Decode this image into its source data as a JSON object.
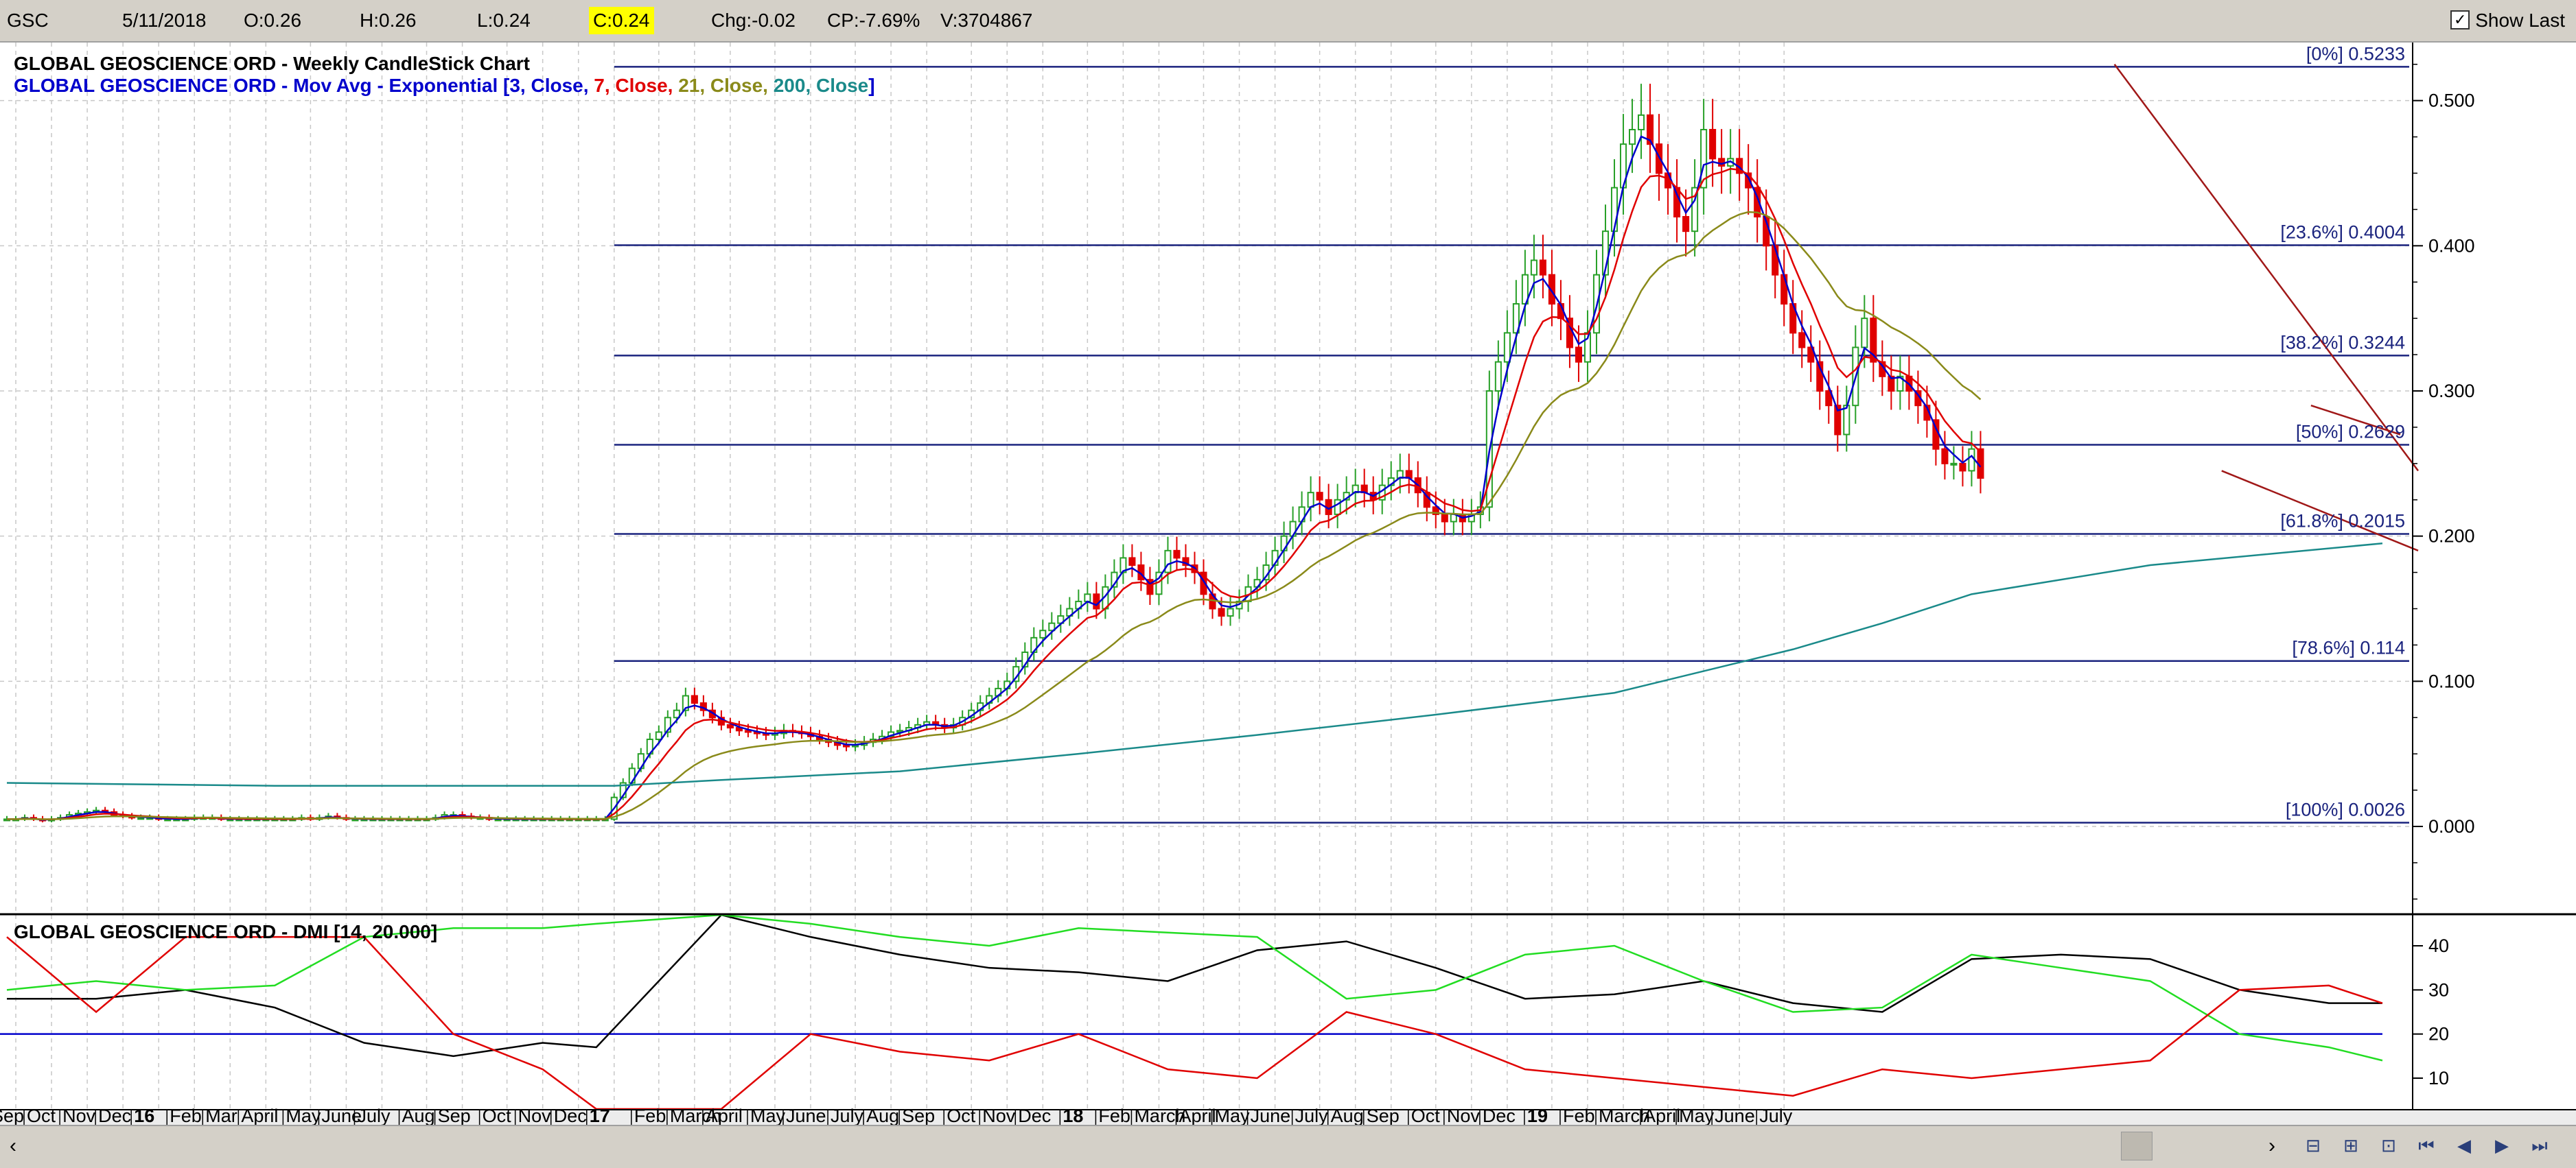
{
  "toolbar": {
    "symbol": "GSC",
    "date": "5/11/2018",
    "open": "O:0.26",
    "high": "H:0.26",
    "low": "L:0.24",
    "close": "C:0.24",
    "change": "Chg:-0.02",
    "change_pct": "CP:-7.69%",
    "volume": "V:3704867",
    "show_last_label": "Show Last",
    "show_last_checked": "✓"
  },
  "chart_data": [
    {
      "type": "candlestick",
      "title": "GLOBAL GEOSCIENCE ORD - Weekly CandleStick Chart",
      "indicator_prefix": "GLOBAL GEOSCIENCE ORD - Mov Avg - Exponential [",
      "indicator_parts": [
        {
          "text": "3, Close, ",
          "color": "#0000cc"
        },
        {
          "text": "7, Close, ",
          "color": "#e00000"
        },
        {
          "text": "21, Close, ",
          "color": "#8a8a1a"
        },
        {
          "text": "200, Close",
          "color": "#1a8a8a"
        }
      ],
      "indicator_suffix": "]",
      "ylim": [
        -0.06,
        0.54
      ],
      "yticks": [
        "0.500",
        "0.400",
        "0.300",
        "0.200",
        "0.100",
        "0.000"
      ],
      "ytick_values": [
        0.5,
        0.4,
        0.3,
        0.2,
        0.1,
        0.0
      ],
      "fib_levels": [
        {
          "label": "[0%] 0.5233",
          "value": 0.5233
        },
        {
          "label": "[23.6%] 0.4004",
          "value": 0.4004
        },
        {
          "label": "[38.2%] 0.3244",
          "value": 0.3244
        },
        {
          "label": "[50%] 0.2629",
          "value": 0.2629
        },
        {
          "label": "[61.8%] 0.2015",
          "value": 0.2015
        },
        {
          "label": "[78.6%] 0.114",
          "value": 0.114
        },
        {
          "label": "[100%] 0.0026",
          "value": 0.0026
        }
      ],
      "fib_start_week": 68,
      "close_series": [
        0.005,
        0.005,
        0.006,
        0.005,
        0.004,
        0.005,
        0.006,
        0.008,
        0.009,
        0.01,
        0.011,
        0.01,
        0.008,
        0.007,
        0.006,
        0.006,
        0.006,
        0.005,
        0.005,
        0.005,
        0.005,
        0.006,
        0.006,
        0.006,
        0.005,
        0.005,
        0.005,
        0.005,
        0.005,
        0.005,
        0.005,
        0.005,
        0.005,
        0.006,
        0.005,
        0.006,
        0.007,
        0.006,
        0.005,
        0.005,
        0.005,
        0.005,
        0.005,
        0.005,
        0.005,
        0.005,
        0.005,
        0.005,
        0.006,
        0.008,
        0.008,
        0.007,
        0.006,
        0.006,
        0.005,
        0.005,
        0.005,
        0.005,
        0.005,
        0.005,
        0.005,
        0.005,
        0.005,
        0.005,
        0.005,
        0.005,
        0.005,
        0.005,
        0.02,
        0.03,
        0.04,
        0.05,
        0.06,
        0.065,
        0.075,
        0.08,
        0.09,
        0.085,
        0.08,
        0.075,
        0.07,
        0.068,
        0.066,
        0.065,
        0.064,
        0.063,
        0.064,
        0.066,
        0.065,
        0.064,
        0.062,
        0.06,
        0.058,
        0.056,
        0.055,
        0.056,
        0.058,
        0.06,
        0.062,
        0.065,
        0.066,
        0.068,
        0.07,
        0.072,
        0.07,
        0.068,
        0.07,
        0.075,
        0.08,
        0.085,
        0.09,
        0.095,
        0.1,
        0.11,
        0.12,
        0.13,
        0.135,
        0.14,
        0.145,
        0.15,
        0.155,
        0.16,
        0.15,
        0.165,
        0.175,
        0.185,
        0.18,
        0.17,
        0.16,
        0.175,
        0.19,
        0.185,
        0.18,
        0.175,
        0.16,
        0.15,
        0.145,
        0.15,
        0.155,
        0.165,
        0.17,
        0.18,
        0.19,
        0.2,
        0.21,
        0.22,
        0.23,
        0.225,
        0.215,
        0.225,
        0.23,
        0.235,
        0.23,
        0.225,
        0.235,
        0.24,
        0.245,
        0.24,
        0.23,
        0.22,
        0.215,
        0.21,
        0.215,
        0.21,
        0.215,
        0.22,
        0.3,
        0.32,
        0.34,
        0.36,
        0.38,
        0.39,
        0.38,
        0.36,
        0.35,
        0.33,
        0.32,
        0.34,
        0.38,
        0.41,
        0.44,
        0.47,
        0.48,
        0.49,
        0.47,
        0.45,
        0.44,
        0.42,
        0.41,
        0.44,
        0.48,
        0.46,
        0.455,
        0.46,
        0.45,
        0.44,
        0.42,
        0.4,
        0.38,
        0.36,
        0.34,
        0.33,
        0.32,
        0.3,
        0.29,
        0.27,
        0.29,
        0.33,
        0.35,
        0.32,
        0.31,
        0.3,
        0.31,
        0.3,
        0.29,
        0.28,
        0.26,
        0.25,
        0.25,
        0.245,
        0.26,
        0.24
      ],
      "ema": [
        {
          "period": 3,
          "color": "#0000cc"
        },
        {
          "period": 7,
          "color": "#e00000"
        },
        {
          "period": 21,
          "color": "#8a8a1a"
        }
      ],
      "ema200": {
        "color": "#1a8a8a",
        "x": [
          0,
          30,
          68,
          80,
          100,
          120,
          140,
          160,
          180,
          200,
          210,
          220,
          240,
          266
        ],
        "y": [
          0.03,
          0.028,
          0.028,
          0.032,
          0.038,
          0.05,
          0.063,
          0.077,
          0.092,
          0.122,
          0.14,
          0.16,
          0.18,
          0.195
        ]
      },
      "trendlines": [
        {
          "x": [
            236,
            270
          ],
          "y": [
            0.525,
            0.245
          ],
          "color": "#a01818"
        },
        {
          "x": [
            248,
            270
          ],
          "y": [
            0.245,
            0.19
          ],
          "color": "#a01818"
        },
        {
          "x": [
            258,
            268
          ],
          "y": [
            0.29,
            0.27
          ],
          "color": "#a01818"
        }
      ]
    },
    {
      "type": "line",
      "title": "GLOBAL GEOSCIENCE ORD - DMI [14, 20.000]",
      "ylim": [
        3,
        47
      ],
      "yticks": [
        "40",
        "30",
        "20",
        "10"
      ],
      "ytick_values": [
        40,
        30,
        20,
        10
      ],
      "threshold": 20,
      "series": [
        {
          "color": "#000000",
          "x": [
            0,
            10,
            20,
            30,
            40,
            50,
            60,
            66,
            80,
            90,
            100,
            110,
            120,
            130,
            140,
            150,
            160,
            170,
            180,
            190,
            200,
            210,
            220,
            230,
            240,
            250,
            260,
            266
          ],
          "y": [
            28,
            28,
            30,
            26,
            18,
            15,
            18,
            17,
            47,
            42,
            38,
            35,
            34,
            32,
            39,
            41,
            35,
            28,
            29,
            32,
            27,
            25,
            37,
            38,
            37,
            30,
            27,
            27
          ]
        },
        {
          "color": "#22dd22",
          "x": [
            0,
            10,
            20,
            30,
            40,
            50,
            60,
            66,
            80,
            90,
            100,
            110,
            120,
            130,
            140,
            150,
            160,
            170,
            180,
            190,
            200,
            210,
            220,
            230,
            240,
            250,
            260,
            266
          ],
          "y": [
            30,
            32,
            30,
            31,
            42,
            44,
            44,
            45,
            47,
            45,
            42,
            40,
            44,
            43,
            42,
            28,
            30,
            38,
            40,
            32,
            25,
            26,
            38,
            35,
            32,
            20,
            17,
            14
          ]
        },
        {
          "color": "#e00000",
          "x": [
            0,
            10,
            20,
            30,
            40,
            50,
            60,
            66,
            80,
            90,
            100,
            110,
            120,
            130,
            140,
            150,
            160,
            170,
            180,
            190,
            200,
            210,
            220,
            230,
            240,
            250,
            260,
            266
          ],
          "y": [
            42,
            25,
            42,
            42,
            42,
            20,
            12,
            3,
            3,
            20,
            16,
            14,
            20,
            12,
            10,
            25,
            20,
            12,
            10,
            8,
            6,
            12,
            10,
            12,
            14,
            30,
            31,
            27
          ]
        }
      ]
    }
  ],
  "x_axis": {
    "labels": [
      "Sep",
      "Oct",
      "Nov",
      "Dec",
      "16",
      "Feb",
      "Mar",
      "April",
      "May",
      "June",
      "July",
      "Aug",
      "Sep",
      "Oct",
      "Nov",
      "Dec",
      "17",
      "Feb",
      "March",
      "April",
      "May",
      "June",
      "July",
      "Aug",
      "Sep",
      "Oct",
      "Nov",
      "Dec",
      "18",
      "Feb",
      "March",
      "April",
      "May",
      "June",
      "July",
      "Aug",
      "Sep",
      "Oct",
      "Nov",
      "Dec",
      "19",
      "Feb",
      "March",
      "April",
      "May",
      "June",
      "July"
    ],
    "bold": [
      "16",
      "17",
      "18",
      "19"
    ],
    "week_index": [
      1,
      5,
      9,
      13,
      17,
      21,
      25,
      29,
      34,
      38,
      42,
      47,
      51,
      56,
      60,
      64,
      68,
      73,
      77,
      81,
      86,
      90,
      95,
      99,
      103,
      108,
      112,
      116,
      121,
      125,
      129,
      134,
      138,
      142,
      147,
      151,
      155,
      160,
      164,
      168,
      173,
      177,
      181,
      186,
      190,
      194,
      199
    ]
  },
  "colors": {
    "up_candle": "#28a028",
    "down_candle": "#e00000",
    "fib_line": "#1a237e",
    "grid": "#c8c8c8",
    "threshold_line": "#0000cc"
  }
}
